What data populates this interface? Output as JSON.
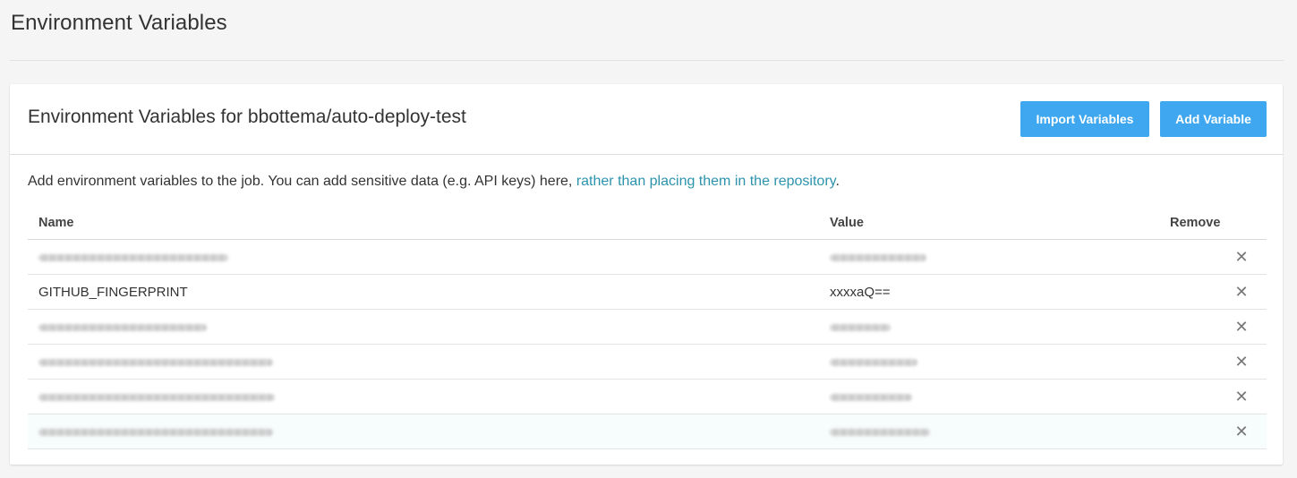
{
  "page": {
    "title": "Environment Variables"
  },
  "card": {
    "title": "Environment Variables for bbottema/auto-deploy-test",
    "import_button": "Import Variables",
    "add_button": "Add Variable",
    "description_text": "Add environment variables to the job. You can add sensitive data (e.g. API keys) here, ",
    "description_link": "rather than placing them in the repository",
    "description_end": "."
  },
  "table": {
    "headers": {
      "name": "Name",
      "value": "Value",
      "remove": "Remove"
    },
    "rows": [
      {
        "name": "",
        "value": "",
        "redacted": true
      },
      {
        "name": "GITHUB_FINGERPRINT",
        "value": "xxxxaQ==",
        "redacted": false
      },
      {
        "name": "",
        "value": "",
        "redacted": true
      },
      {
        "name": "",
        "value": "",
        "redacted": true
      },
      {
        "name": "",
        "value": "",
        "redacted": true
      },
      {
        "name": "",
        "value": "",
        "redacted": true,
        "highlighted": true
      }
    ],
    "remove_icon": "close-icon",
    "remove_glyph": "✕"
  },
  "colors": {
    "accent": "#3ea7f0",
    "link": "#2d93ad",
    "background": "#f5f5f5"
  }
}
